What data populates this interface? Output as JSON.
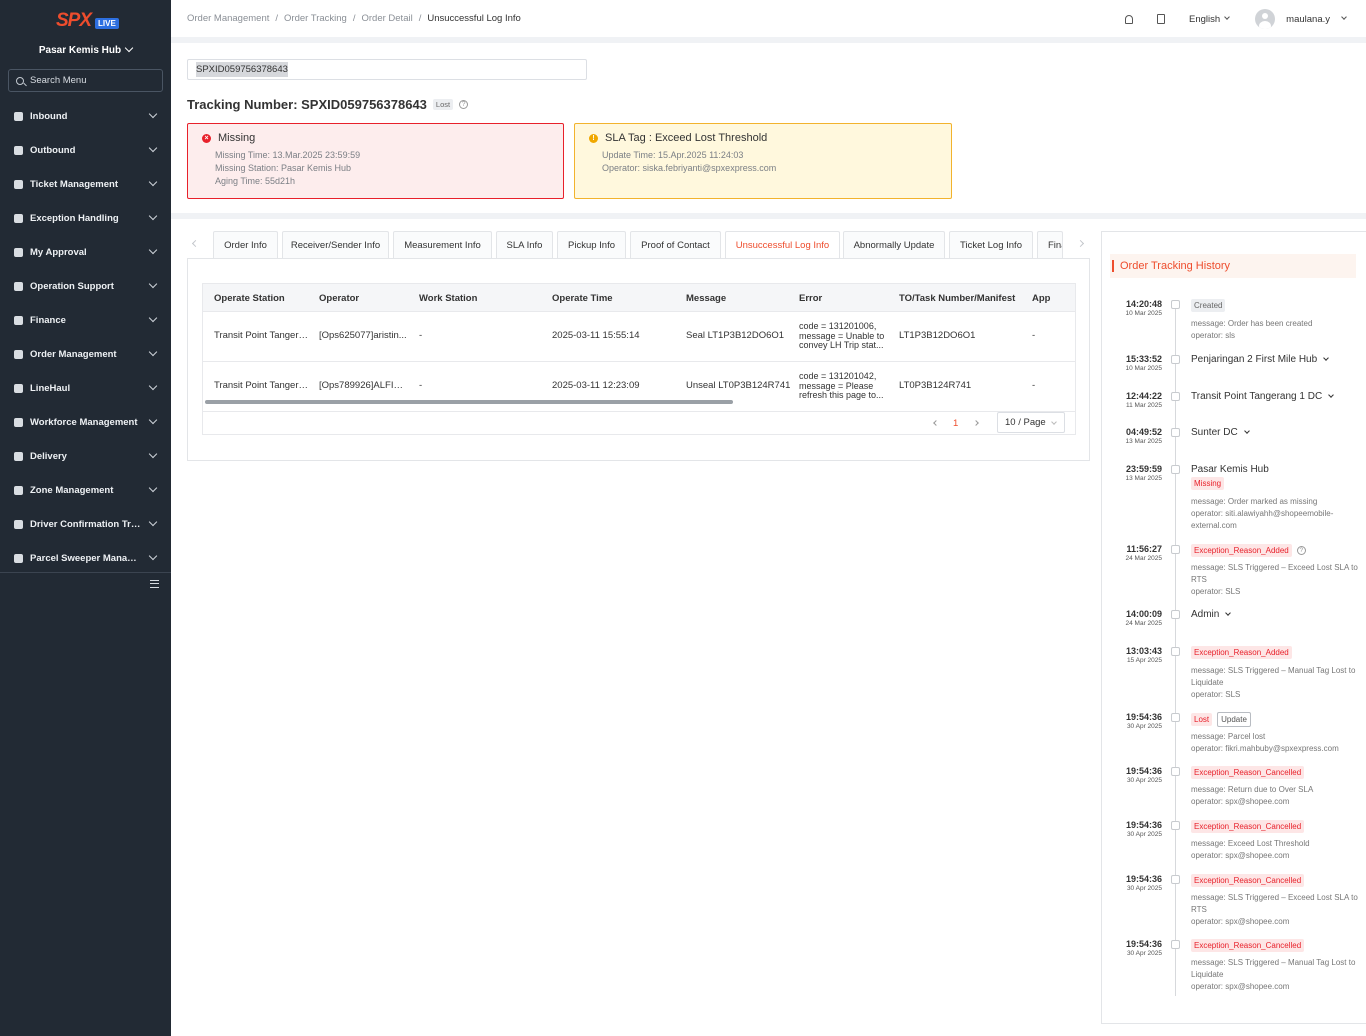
{
  "sidebar": {
    "logo_text": "SPX",
    "logo_badge": "LIVE",
    "hub": "Pasar Kemis Hub",
    "search_placeholder": "Search Menu",
    "items": [
      {
        "label": "Inbound",
        "icon": "inbound-icon"
      },
      {
        "label": "Outbound",
        "icon": "outbound-icon"
      },
      {
        "label": "Ticket Management",
        "icon": "ticket-icon"
      },
      {
        "label": "Exception Handling",
        "icon": "exception-icon"
      },
      {
        "label": "My Approval",
        "icon": "approval-icon"
      },
      {
        "label": "Operation Support",
        "icon": "operation-icon"
      },
      {
        "label": "Finance",
        "icon": "finance-icon"
      },
      {
        "label": "Order Management",
        "icon": "order-icon"
      },
      {
        "label": "LineHaul",
        "icon": "truck-icon"
      },
      {
        "label": "Workforce Management",
        "icon": "workforce-icon"
      },
      {
        "label": "Delivery",
        "icon": "delivery-icon"
      },
      {
        "label": "Zone Management",
        "icon": "zone-icon"
      },
      {
        "label": "Driver Confirmation Track...",
        "icon": "driver-icon"
      },
      {
        "label": "Parcel Sweeper Manage...",
        "icon": "sweeper-icon"
      }
    ]
  },
  "header": {
    "breadcrumb": [
      "Order Management",
      "Order Tracking",
      "Order Detail",
      "Unsuccessful Log Info"
    ],
    "language": "English",
    "user": "maulana.y"
  },
  "tracking": {
    "search_value": "SPXID059756378643",
    "title": "Tracking Number: SPXID059756378643",
    "status_tag": "Lost"
  },
  "alerts": {
    "missing": {
      "title": "Missing",
      "time": "Missing Time: 13.Mar.2025 23:59:59",
      "station": "Missing Station: Pasar Kemis Hub",
      "aging": "Aging Time: 55d21h"
    },
    "sla": {
      "title": "SLA Tag : Exceed Lost Threshold",
      "update": "Update Time: 15.Apr.2025 11:24:03",
      "operator": "Operator: siska.febriyanti@spxexpress.com"
    }
  },
  "tabs": [
    "Order Info",
    "Receiver/Sender Info",
    "Measurement Info",
    "SLA Info",
    "Pickup Info",
    "Proof of Contact",
    "Unsuccessful Log Info",
    "Abnormally Update",
    "Ticket Log Info",
    "Fina"
  ],
  "table": {
    "columns": [
      "Operate Station",
      "Operator",
      "Work Station",
      "Operate Time",
      "Message",
      "Error",
      "TO/Task Number/Manifest",
      "App"
    ],
    "rows": [
      [
        "Transit Point Tangera...",
        "[Ops625077]aristin...",
        "-",
        "2025-03-11 15:55:14",
        "Seal LT1P3B12DO6O1",
        "code = 131201006, message = Unable to convey LH Trip stat...",
        "LT1P3B12DO6O1",
        "-"
      ],
      [
        "Transit Point Tangera...",
        "[Ops789926]ALFIN ...",
        "-",
        "2025-03-11 12:23:09",
        "Unseal LT0P3B124R741",
        "code = 131201042, message = Please refresh this page to...",
        "LT0P3B124R741",
        "-"
      ]
    ],
    "page": "1",
    "page_size": "10 / Page"
  },
  "history": {
    "title": "Order Tracking History",
    "events": [
      {
        "time": "14:20:48",
        "date": "10 Mar 2025",
        "title": "",
        "badge": "Created",
        "msg": "message: Order has been created",
        "op": "operator: sls"
      },
      {
        "time": "15:33:52",
        "date": "10 Mar 2025",
        "title": "Penjaringan 2 First Mile Hub"
      },
      {
        "time": "12:44:22",
        "date": "11 Mar 2025",
        "title": "Transit Point Tangerang 1 DC"
      },
      {
        "time": "04:49:52",
        "date": "13 Mar 2025",
        "title": "Sunter DC"
      },
      {
        "time": "23:59:59",
        "date": "13 Mar 2025",
        "title": "Pasar Kemis Hub",
        "badge": "Missing",
        "msg": "message: Order marked as missing",
        "op": "operator: siti.alawiyahh@shopeemobile-external.com"
      },
      {
        "time": "11:56:27",
        "date": "24 Mar 2025",
        "badge": "Exception_Reason_Added",
        "msg": "message: SLS Triggered – Exceed Lost SLA to RTS",
        "op": "operator: SLS"
      },
      {
        "time": "14:00:09",
        "date": "24 Mar 2025",
        "title": "Admin"
      },
      {
        "time": "13:03:43",
        "date": "15 Apr 2025",
        "badge": "Exception_Reason_Added",
        "msg": "message: SLS Triggered – Manual Tag Lost to Liquidate",
        "op": "operator: SLS"
      },
      {
        "time": "19:54:36",
        "date": "30 Apr 2025",
        "badge": "Lost",
        "badge2": "Update",
        "msg": "message: Parcel lost",
        "op": "operator: fikri.mahbuby@spxexpress.com"
      },
      {
        "time": "19:54:36",
        "date": "30 Apr 2025",
        "badge": "Exception_Reason_Cancelled",
        "msg": "message: Return due to Over SLA",
        "op": "operator: spx@shopee.com"
      },
      {
        "time": "19:54:36",
        "date": "30 Apr 2025",
        "badge": "Exception_Reason_Cancelled",
        "msg": "message: Exceed Lost Threshold",
        "op": "operator: spx@shopee.com"
      },
      {
        "time": "19:54:36",
        "date": "30 Apr 2025",
        "badge": "Exception_Reason_Cancelled",
        "msg": "message: SLS Triggered – Exceed Lost SLA to RTS",
        "op": "operator: spx@shopee.com"
      },
      {
        "time": "19:54:36",
        "date": "30 Apr 2025",
        "badge": "Exception_Reason_Cancelled",
        "msg": "message: SLS Triggered – Manual Tag Lost to Liquidate",
        "op": "operator: spx@shopee.com"
      }
    ]
  }
}
